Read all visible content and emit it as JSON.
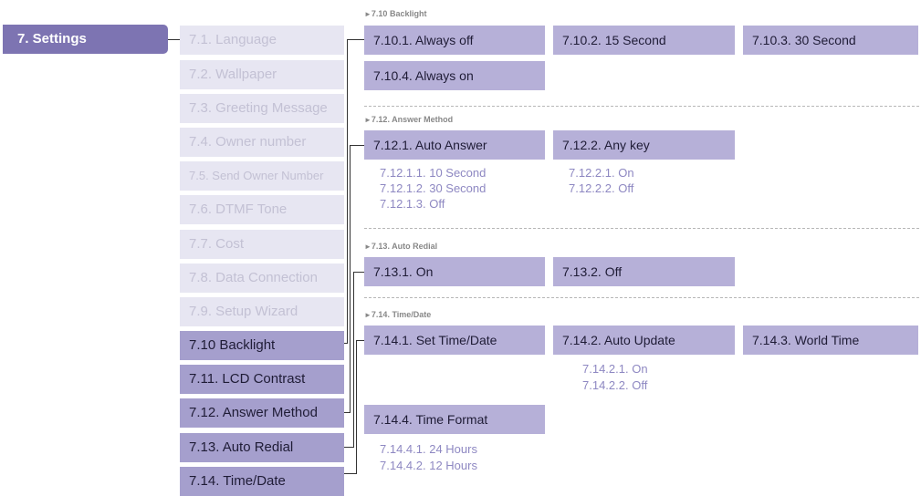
{
  "root": {
    "label": "7. Settings"
  },
  "menu": [
    "7.1. Language",
    "7.2. Wallpaper",
    "7.3. Greeting Message",
    "7.4. Owner number",
    "7.5. Send Owner Number",
    "7.6. DTMF Tone",
    "7.7. Cost",
    "7.8. Data Connection",
    "7.9. Setup Wizard",
    "7.10 Backlight",
    "7.11. LCD Contrast",
    "7.12. Answer Method",
    "7.13. Auto Redial",
    "7.14. Time/Date"
  ],
  "sections": {
    "backlight": {
      "title": "7.10 Backlight",
      "items": [
        "7.10.1. Always off",
        "7.10.2. 15 Second",
        "7.10.3. 30 Second",
        "7.10.4. Always on"
      ]
    },
    "answer": {
      "title": "7.12. Answer Method",
      "items": [
        "7.12.1. Auto Answer",
        "7.12.2. Any key"
      ],
      "auto_answer_sub": [
        "7.12.1.1. 10 Second",
        "7.12.1.2. 30 Second",
        "7.12.1.3. Off"
      ],
      "any_key_sub": [
        "7.12.2.1. On",
        "7.12.2.2. Off"
      ]
    },
    "redial": {
      "title": "7.13. Auto Redial",
      "items": [
        "7.13.1. On",
        "7.13.2. Off"
      ]
    },
    "timedate": {
      "title": "7.14. Time/Date",
      "items": [
        "7.14.1. Set Time/Date",
        "7.14.2. Auto Update",
        "7.14.3. World Time",
        "7.14.4. Time Format"
      ],
      "auto_update_sub": [
        "7.14.2.1. On",
        "7.14.2.2. Off"
      ],
      "time_format_sub": [
        "7.14.4.1. 24 Hours",
        "7.14.4.2. 12 Hours"
      ]
    }
  },
  "colors": {
    "root_bg": "#7d74b2",
    "menu_inactive_bg": "#e7e6f2",
    "menu_inactive_text": "#c3c1d4",
    "menu_active_bg": "#a59fcd",
    "option_bg": "#b6b0d8",
    "sub_option_text": "#8e88c2",
    "connector": "#333333"
  }
}
